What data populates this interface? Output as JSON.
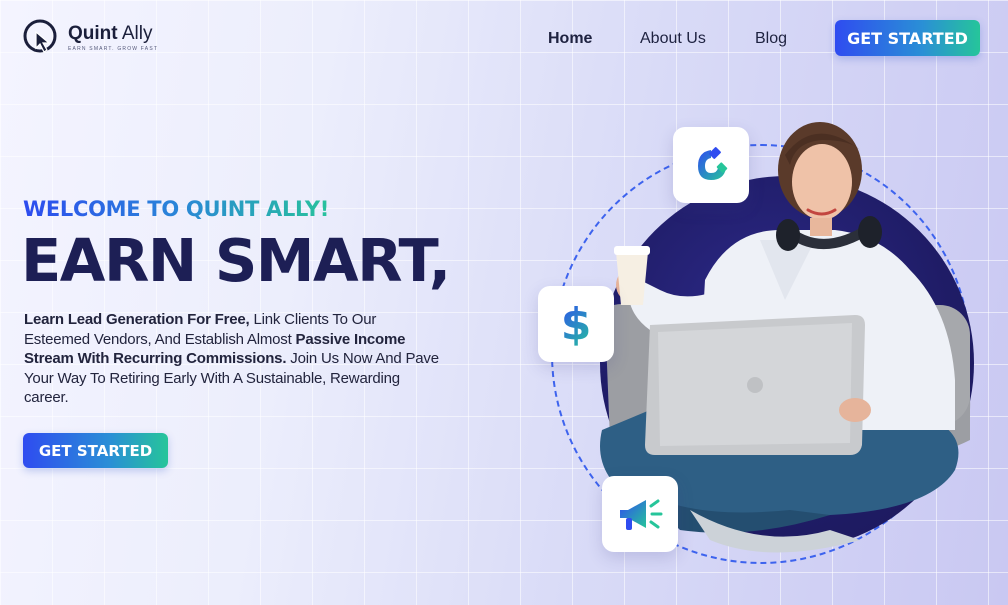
{
  "brand": {
    "name_bold": "Quint",
    "name_light": "Ally",
    "tagline": "EARN SMART. GROW FAST"
  },
  "nav": {
    "items": [
      {
        "label": "Home",
        "active": true
      },
      {
        "label": "About Us",
        "active": false
      },
      {
        "label": "Blog",
        "active": false
      }
    ],
    "cta_label": "GET STARTED"
  },
  "hero": {
    "welcome": "WELCOME TO QUINT ALLY!",
    "headline": "EARN SMART,",
    "desc_1_bold": "Learn Lead Generation For Free,",
    "desc_2": " Link Clients To Our Esteemed Vendors, And Establish Almost ",
    "desc_3_bold": "Passive Income Stream With Recurring Commissions.",
    "desc_4": " Join Us Now And Pave  Your Way To Retiring Early With A Sustainable, Rewarding career.",
    "cta_label": "GET STARTED"
  },
  "cards": [
    {
      "icon": "magnet-icon"
    },
    {
      "icon": "dollar-icon",
      "symbol": "$"
    },
    {
      "icon": "megaphone-icon"
    }
  ],
  "colors": {
    "accent_blue": "#2f4cf0",
    "accent_green": "#26c59a",
    "headline": "#1d1f55"
  }
}
